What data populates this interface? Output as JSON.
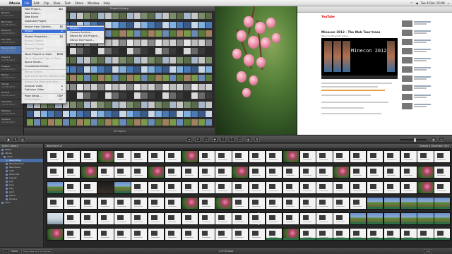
{
  "menubar": {
    "app": "iMovie",
    "items": [
      "File",
      "Edit",
      "Clip",
      "View",
      "Text",
      "Share",
      "Window",
      "Help"
    ],
    "active_index": 0,
    "clock": "Tue 4 Dec 15:09"
  },
  "file_menu": {
    "items": [
      {
        "label": "New Project...",
        "shortcut": "⌘N",
        "disabled": false
      },
      {
        "label": "New Folder...",
        "shortcut": "",
        "disabled": false
      },
      {
        "label": "New Event",
        "shortcut": "",
        "disabled": false
      },
      {
        "label": "Duplicate Project",
        "shortcut": "",
        "disabled": false
      },
      {
        "sep": true
      },
      {
        "label": "Import from Camera...",
        "shortcut": "⌘I",
        "disabled": false
      },
      {
        "label": "Import",
        "shortcut": "▸",
        "disabled": false,
        "highlight": true
      },
      {
        "sep": true
      },
      {
        "label": "Project Properties...",
        "shortcut": "⌘J",
        "disabled": false
      },
      {
        "label": "Project Theme...",
        "shortcut": "",
        "disabled": true
      },
      {
        "label": "Reveal in Finder",
        "shortcut": "",
        "disabled": true
      },
      {
        "label": "Finalise Project",
        "shortcut": "",
        "disabled": true
      },
      {
        "sep": true
      },
      {
        "label": "Move Project to Trash",
        "shortcut": "⌘⌫",
        "disabled": false
      },
      {
        "label": "Move Rejected Clips to Trash",
        "shortcut": "",
        "disabled": true
      },
      {
        "label": "Space Saver...",
        "shortcut": "",
        "disabled": false
      },
      {
        "label": "Consolidate Media...",
        "shortcut": "",
        "disabled": false
      },
      {
        "sep": true
      },
      {
        "label": "Merge Events",
        "shortcut": "",
        "disabled": true
      },
      {
        "label": "Split Event Before Selected Clip",
        "shortcut": "",
        "disabled": true
      },
      {
        "sep": true
      },
      {
        "label": "Adjust Clip Date and Time...",
        "shortcut": "",
        "disabled": true
      },
      {
        "label": "Analyse Video",
        "shortcut": "▸",
        "disabled": false
      },
      {
        "label": "Optimize Video",
        "shortcut": "▸",
        "disabled": false
      },
      {
        "sep": true
      },
      {
        "label": "Page Setup...",
        "shortcut": "⇧⌘P",
        "disabled": false
      },
      {
        "label": "Print Project...",
        "shortcut": "⌘P",
        "disabled": true
      }
    ]
  },
  "import_submenu": {
    "items": [
      "Movies...",
      "Camera Archive...",
      "iMovie for iOS Project...",
      "iMovie HD Project..."
    ],
    "highlight_index": 0
  },
  "project_library": {
    "title": "Project Library",
    "projects": [
      {
        "name": "Minecon",
        "info": "11 Dec 2012",
        "selected": false
      },
      {
        "name": "Mon 3 Dec",
        "info": "Last Modified:",
        "selected": false
      },
      {
        "name": "Minecon3",
        "info": "Last Modified:",
        "selected": false
      },
      {
        "name": "Tue 4 Dec",
        "info": "Last Modified:",
        "selected": false
      },
      {
        "name": "Minecon 2012",
        "info": "Last Modified:",
        "selected": true
      },
      {
        "name": "Project 2",
        "info": "Last Modified:",
        "selected": false
      },
      {
        "name": "Creative",
        "info": "Last Modified:",
        "selected": false
      },
      {
        "name": "Biomes",
        "info": "Last Modified:",
        "selected": false
      },
      {
        "name": "Tutorial",
        "info": "Last Modified:",
        "selected": false
      },
      {
        "name": "Survival",
        "info": "Last Modified:",
        "selected": false
      },
      {
        "name": "Adventure",
        "info": "Last Modified:",
        "selected": false
      },
      {
        "name": "Redstone",
        "info": "Last Modified:",
        "selected": false
      },
      {
        "name": "Skyblock",
        "info": "Last Modified:",
        "selected": false
      }
    ],
    "footer": "15 Projects"
  },
  "browser_preview": {
    "site": "YouTube",
    "video_title": "Minecon 2012 - The Web Tour trees",
    "video_sub": "Minecon Minecraft Videos",
    "overlay": "Minecon 2012"
  },
  "toolbar": {
    "buttons": [
      "⌖",
      "↶",
      "✂",
      "✚",
      "♪",
      "T",
      "⟲",
      "◐",
      "⚙"
    ]
  },
  "event_library": {
    "title": "Event Library",
    "events": [
      {
        "label": "iPhoto",
        "selected": false
      },
      {
        "label": "iMovie",
        "selected": false
      },
      {
        "label": "2012",
        "selected": false
      },
      {
        "label": "Recordings",
        "selected": true
      },
      {
        "label": "New Event 11",
        "selected": false
      },
      {
        "label": "New Event",
        "selected": false
      },
      {
        "label": "Clips",
        "selected": false
      },
      {
        "label": "Minecraft",
        "selected": false
      },
      {
        "label": "August",
        "selected": false
      },
      {
        "label": "July",
        "selected": false
      },
      {
        "label": "June",
        "selected": false
      },
      {
        "label": "May",
        "selected": false
      },
      {
        "label": "April",
        "selected": false
      },
      {
        "label": "March",
        "selected": false
      },
      {
        "label": "January",
        "selected": false
      },
      {
        "label": "2011",
        "selected": false
      }
    ]
  },
  "event_browser": {
    "title": "New Event 11",
    "date": "Tuesday 4 December 2012"
  },
  "statusbar": {
    "show_label": "Show:",
    "filter": "Favourites and Unmarked",
    "center": "2:37:30 total",
    "zoom": "1/2s"
  }
}
